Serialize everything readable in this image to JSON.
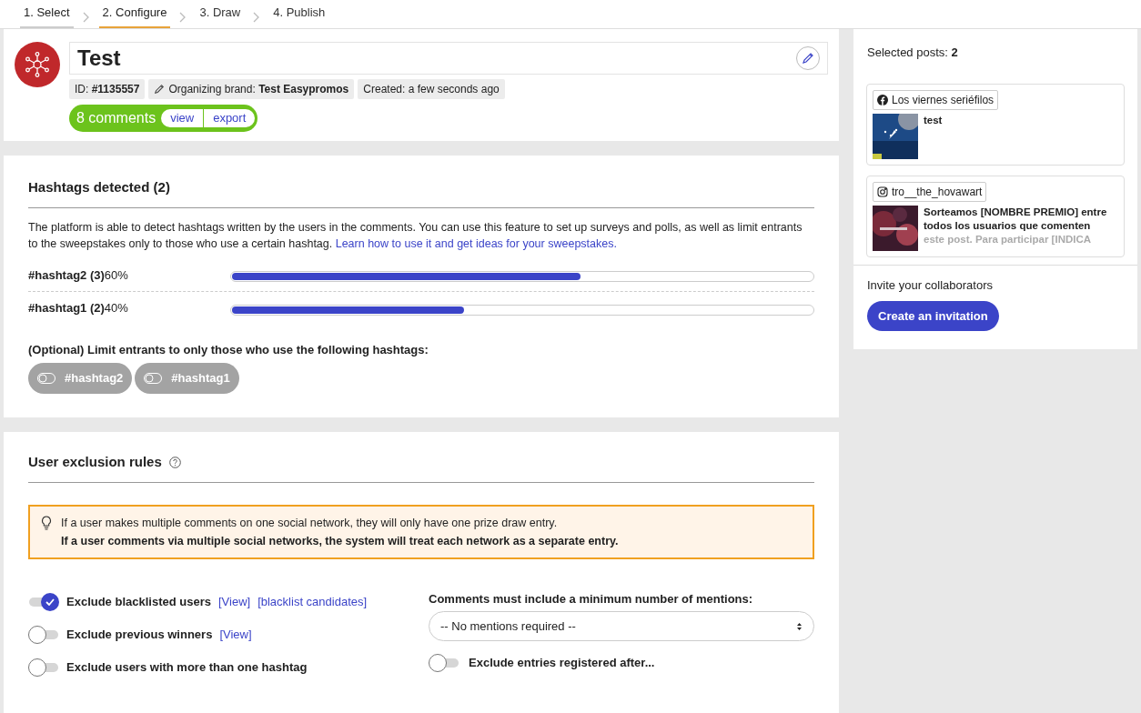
{
  "steps": [
    {
      "label": "1. Select",
      "selected": false,
      "done": true
    },
    {
      "label": "2. Configure",
      "selected": true,
      "done": true
    },
    {
      "label": "3. Draw",
      "selected": false,
      "done": false
    },
    {
      "label": "4. Publish",
      "selected": false,
      "done": false
    }
  ],
  "promotion": {
    "title": "Test",
    "id_label": "ID:",
    "id": "#1135557",
    "brand_label": "Organizing brand:",
    "brand": "Test Easypromos",
    "created": "Created: a few seconds ago",
    "comments": "8 comments",
    "view": "view",
    "export": "export"
  },
  "hashtags": {
    "title": "Hashtags detected (2)",
    "description": "The platform is able to detect hashtags written by the users in the comments. You can use this feature to set up surveys and polls, as well as limit entrants to the sweepstakes only to those who use a certain hashtag.",
    "link": "Learn how to use it and get ideas for your sweepstakes.",
    "rows": [
      {
        "tag": "#hashtag2 (3)",
        "percent": "60%",
        "level": 0.6
      },
      {
        "tag": "#hashtag1 (2)",
        "percent": "40%",
        "level": 0.4
      }
    ],
    "limit_label": "(Optional) Limit entrants to only those who use the following hashtags:",
    "chips": [
      {
        "label": "#hashtag2",
        "on": false
      },
      {
        "label": "#hashtag1",
        "on": false
      }
    ]
  },
  "exclusion": {
    "title": "User exclusion rules",
    "notice_line1": "If a user makes multiple comments on one social network, they will only have one prize draw entry.",
    "notice_line2": "If a user comments via multiple social networks, the system will treat each network as a separate entry.",
    "rules": [
      {
        "label": "Exclude blacklisted users",
        "on": true,
        "links": [
          "[View]",
          "[blacklist candidates]"
        ]
      },
      {
        "label": "Exclude previous winners",
        "on": false,
        "links": [
          "[View]"
        ]
      },
      {
        "label": "Exclude users with more than one hashtag",
        "on": false
      }
    ],
    "mentions_label": "Comments must include a minimum number of mentions:",
    "mentions_value": "-- No mentions required --",
    "after_rule": {
      "label": "Exclude entries registered after...",
      "on": false
    }
  },
  "sidebar": {
    "selected_label": "Selected posts:",
    "selected_count": "2",
    "posts": [
      {
        "kind": "facebook",
        "account": "Los viernes seriéfilos",
        "text": "test"
      },
      {
        "kind": "instagram",
        "account": "tro__the_hovawart",
        "text": "Sorteamos [NOMBRE PREMIO] entre todos los usuarios que comenten",
        "text_faded": "este post. Para participar [INDICA"
      }
    ],
    "invite_label": "Invite your collaborators",
    "invite_button": "Create an invitation"
  }
}
